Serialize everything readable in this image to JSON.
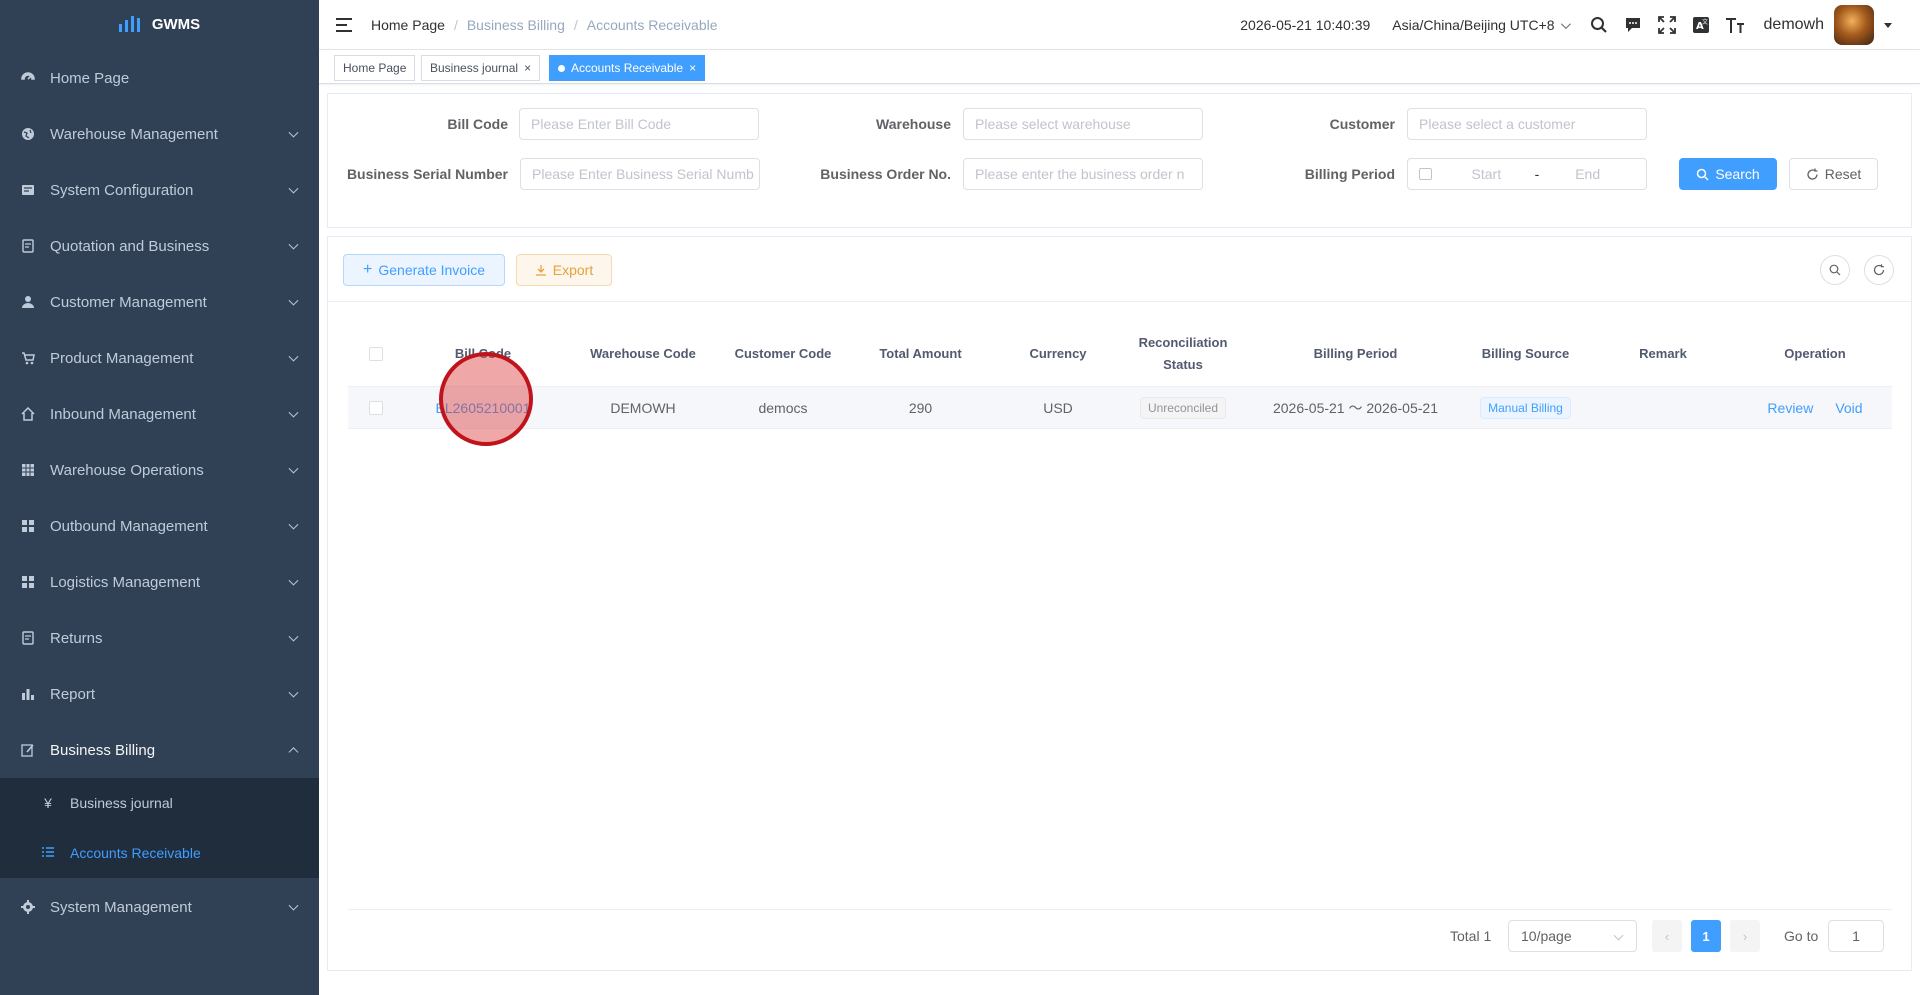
{
  "app": {
    "logo_text": "GWMS"
  },
  "sidebar": {
    "items": [
      {
        "label": "Home Page",
        "icon": "dashboard-icon"
      },
      {
        "label": "Warehouse Management",
        "icon": "globe-icon"
      },
      {
        "label": "System Configuration",
        "icon": "config-icon"
      },
      {
        "label": "Quotation and Business",
        "icon": "document-icon"
      },
      {
        "label": "Customer Management",
        "icon": "user-icon"
      },
      {
        "label": "Product Management",
        "icon": "cart-icon"
      },
      {
        "label": "Inbound Management",
        "icon": "home-icon"
      },
      {
        "label": "Warehouse Operations",
        "icon": "table-icon"
      },
      {
        "label": "Outbound Management",
        "icon": "grid-icon"
      },
      {
        "label": "Logistics Management",
        "icon": "grid-icon"
      },
      {
        "label": "Returns",
        "icon": "document-icon"
      },
      {
        "label": "Report",
        "icon": "bar-chart-icon"
      },
      {
        "label": "Business Billing",
        "icon": "edit-icon"
      },
      {
        "label": "System Management",
        "icon": "gear-icon"
      }
    ],
    "submenu": [
      {
        "label": "Business journal",
        "icon": "yen-icon"
      },
      {
        "label": "Accounts Receivable",
        "icon": "list-icon"
      }
    ]
  },
  "header": {
    "breadcrumb": [
      "Home Page",
      "Business Billing",
      "Accounts Receivable"
    ],
    "datetime": "2026-05-21 10:40:39",
    "timezone": "Asia/China/Beijing UTC+8",
    "username": "demowh"
  },
  "tags": [
    "Home Page",
    "Business journal",
    "Accounts Receivable"
  ],
  "search": {
    "bill_code_label": "Bill Code",
    "bill_code_placeholder": "Please Enter Bill Code",
    "warehouse_label": "Warehouse",
    "warehouse_placeholder": "Please select warehouse",
    "customer_label": "Customer",
    "customer_placeholder": "Please select a customer",
    "serial_label": "Business Serial Number",
    "serial_placeholder": "Please Enter Business Serial Numb",
    "order_label": "Business Order No.",
    "order_placeholder": "Please enter the business order n",
    "period_label": "Billing Period",
    "period_start": "Start",
    "period_sep": "-",
    "period_end": "End",
    "search_button": "Search",
    "reset_button": "Reset"
  },
  "toolbar": {
    "generate_invoice": "Generate Invoice",
    "export": "Export"
  },
  "table": {
    "columns": [
      "Bill Code",
      "Warehouse Code",
      "Customer Code",
      "Total Amount",
      "Currency",
      "Reconciliation Status",
      "Billing Period",
      "Billing Source",
      "Remark",
      "Operation"
    ],
    "rows": [
      {
        "bill_code": "BL2605210001",
        "warehouse_code": "DEMOWH",
        "customer_code": "democs",
        "total_amount": "290",
        "currency": "USD",
        "status": "Unreconciled",
        "billing_period": "2026-05-21 ～ 2026-05-21",
        "billing_source": "Manual Billing",
        "remark": "",
        "review": "Review",
        "void": "Void"
      }
    ]
  },
  "pagination": {
    "total": "Total 1",
    "page_size": "10/page",
    "current_page": "1",
    "goto_label": "Go to",
    "goto_value": "1"
  }
}
